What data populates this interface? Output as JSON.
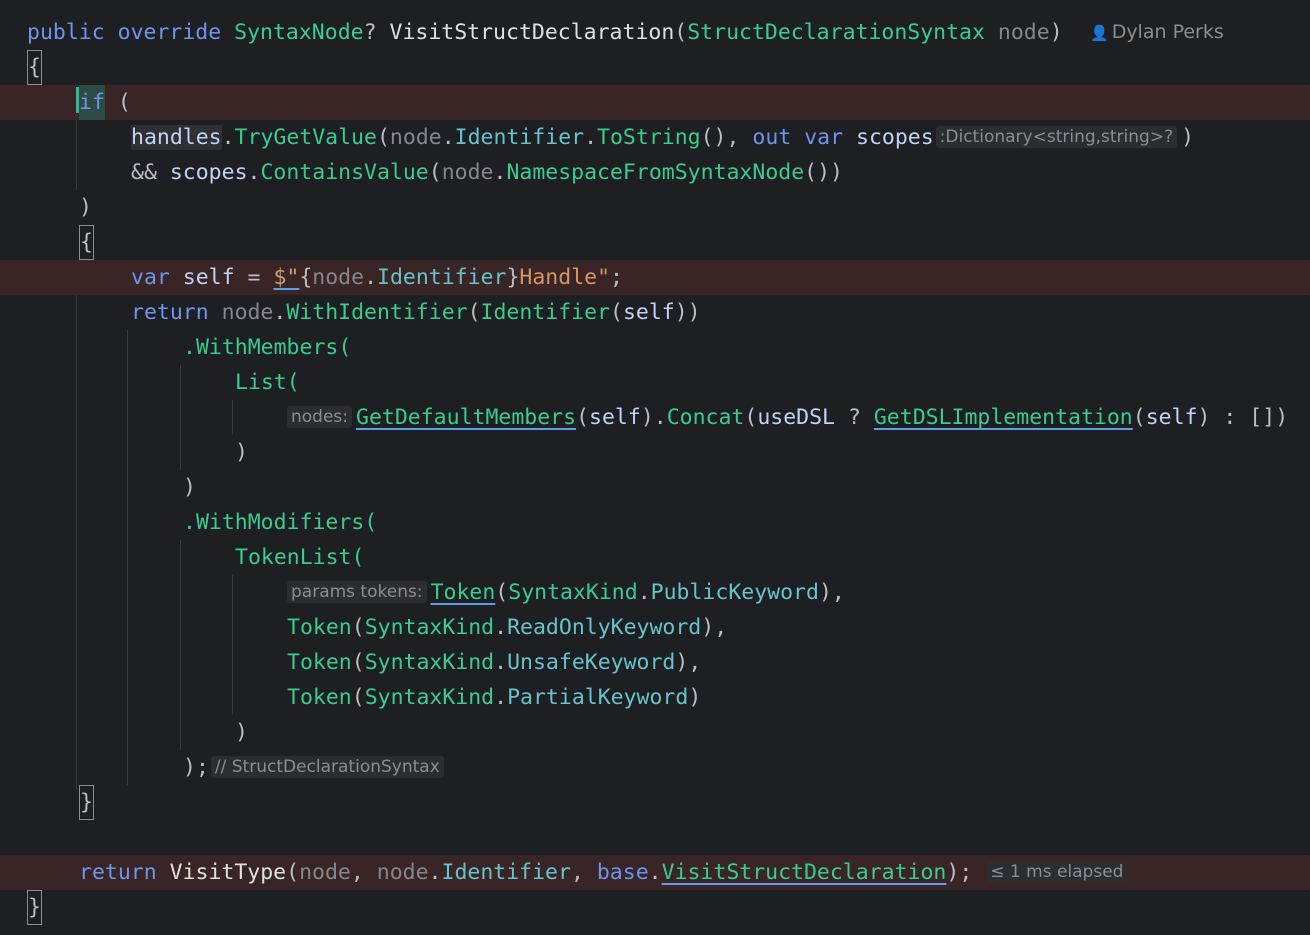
{
  "signature": {
    "public_kw": "public",
    "override_kw": "override",
    "return_type": "SyntaxNode",
    "nullable_mark": "?",
    "method_name": "VisitStructDeclaration",
    "param_type": "StructDeclarationSyntax",
    "param_name": "node",
    "author": "Dylan Perks",
    "author_icon": "user-icon"
  },
  "braces": {
    "open": "{",
    "close": "}"
  },
  "if_block": {
    "if_kw": "if",
    "open_paren": "(",
    "cond_line1": {
      "target": "handles",
      "method": "TryGetValue",
      "arg_obj": "node",
      "arg_prop": "Identifier",
      "arg_call": "ToString",
      "out_kw": "out",
      "var_kw": "var",
      "out_var": "scopes",
      "type_hint": ":Dictionary<string,string>?"
    },
    "cond_line2": {
      "op": "&&",
      "target": "scopes",
      "method": "ContainsValue",
      "arg_obj": "node",
      "arg_call": "NamespaceFromSyntaxNode"
    },
    "close_paren": ")"
  },
  "body": {
    "var_line": {
      "var_kw": "var",
      "name": "self",
      "prefix": "$\"",
      "interp_obj": "node",
      "interp_prop": "Identifier",
      "suffix": "Handle\"",
      "semi": ";"
    },
    "return_line": {
      "return_kw": "return",
      "obj": "node",
      "method": "WithIdentifier",
      "inner": "Identifier",
      "arg": "self"
    },
    "with_members": ".WithMembers(",
    "list_call": "List(",
    "members_line": {
      "hint": "nodes:",
      "call1": "GetDefaultMembers",
      "arg": "self",
      "concat": "Concat",
      "flag": "useDSL",
      "call2": "GetDSLImplementation",
      "empty": "[]"
    },
    "with_modifiers": ".WithModifiers(",
    "tokenlist_call": "TokenList(",
    "tokens_hint": "params tokens:",
    "token_fn": "Token",
    "syntax_kind": "SyntaxKind",
    "tokens": [
      "PublicKeyword",
      "ReadOnlyKeyword",
      "UnsafeKeyword",
      "PartialKeyword"
    ],
    "end_stmt": ");",
    "end_hint": "// StructDeclarationSyntax"
  },
  "final_return": {
    "return_kw": "return",
    "method": "VisitType",
    "arg1": "node",
    "arg2_obj": "node",
    "arg2_prop": "Identifier",
    "base_kw": "base",
    "base_method": "VisitStructDeclaration",
    "elapsed_hint": "≤ 1 ms elapsed"
  },
  "colors": {
    "background": "#1e1f22",
    "highlight_line": "#3a2526",
    "keyword": "#6c95eb",
    "type": "#39cc9b",
    "string": "#c9a26d",
    "caret": "#2ab79a"
  }
}
